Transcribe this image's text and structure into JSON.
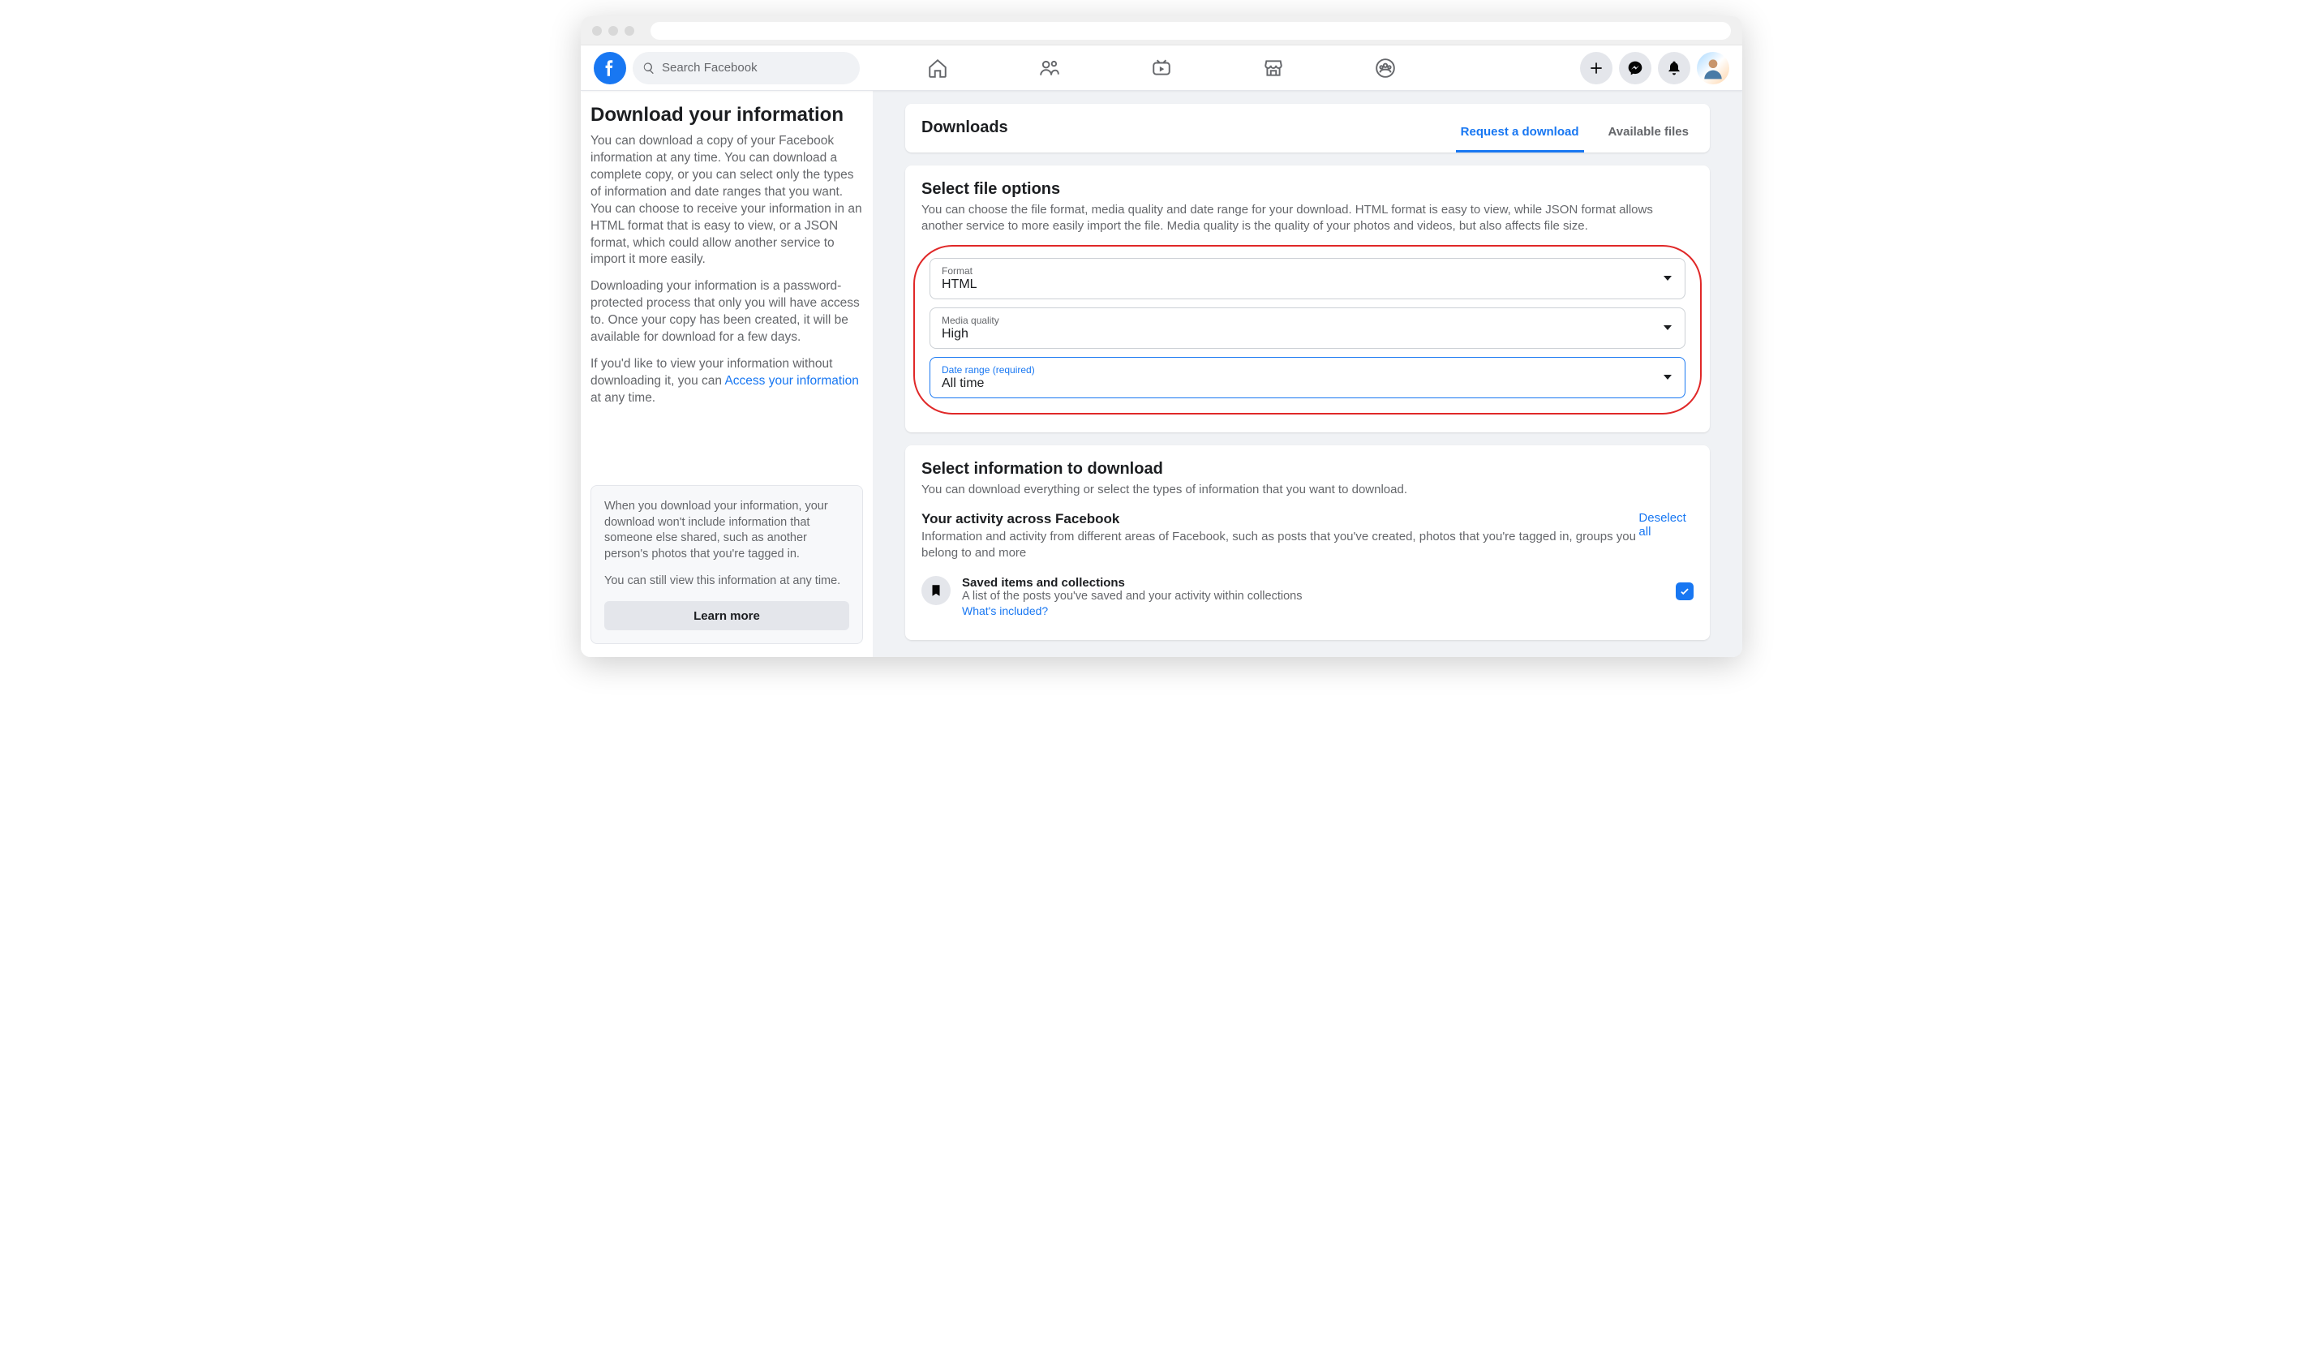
{
  "search_placeholder": "Search Facebook",
  "sidebar": {
    "title": "Download your information",
    "p1": "You can download a copy of your Facebook information at any time. You can download a complete copy, or you can select only the types of information and date ranges that you want. You can choose to receive your information in an HTML format that is easy to view, or a JSON format, which could allow another service to import it more easily.",
    "p2": "Downloading your information is a password-protected process that only you will have access to. Once your copy has been created, it will be available for download for a few days.",
    "p3_a": "If you'd like to view your information without downloading it, you can ",
    "p3_link": "Access your information",
    "p3_b": " at any time.",
    "info1": "When you download your information, your download won't include information that someone else shared, such as another person's photos that you're tagged in.",
    "info2": "You can still view this information at any time.",
    "learn_more": "Learn more"
  },
  "page": {
    "title": "Downloads",
    "tab_request": "Request a download",
    "tab_files": "Available files"
  },
  "options": {
    "title": "Select file options",
    "desc": "You can choose the file format, media quality and date range for your download. HTML format is easy to view, while JSON format allows another service to more easily import the file. Media quality is the quality of your photos and videos, but also affects file size.",
    "format_label": "Format",
    "format_value": "HTML",
    "media_label": "Media quality",
    "media_value": "High",
    "date_label": "Date range (required)",
    "date_value": "All time"
  },
  "info_section": {
    "title": "Select information to download",
    "desc": "You can download everything or select the types of information that you want to download.",
    "sub_heading": "Your activity across Facebook",
    "sub_desc": "Information and activity from different areas of Facebook, such as posts that you've created, photos that you're tagged in, groups you belong to and more",
    "deselect": "Deselect all",
    "item1_title": "Saved items and collections",
    "item1_desc": "A list of the posts you've saved and your activity within collections",
    "whats_included": "What's included?"
  }
}
